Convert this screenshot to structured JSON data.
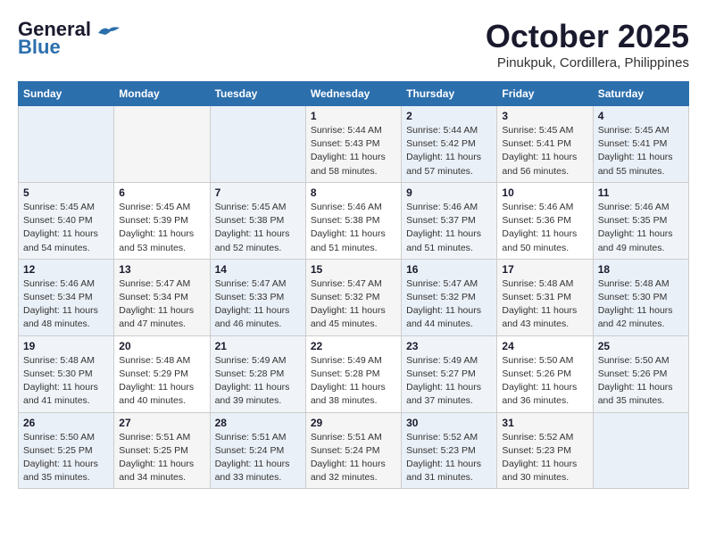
{
  "header": {
    "logo_general": "General",
    "logo_blue": "Blue",
    "month": "October 2025",
    "location": "Pinukpuk, Cordillera, Philippines"
  },
  "days_of_week": [
    "Sunday",
    "Monday",
    "Tuesday",
    "Wednesday",
    "Thursday",
    "Friday",
    "Saturday"
  ],
  "weeks": [
    [
      {
        "day": "",
        "info": ""
      },
      {
        "day": "",
        "info": ""
      },
      {
        "day": "",
        "info": ""
      },
      {
        "day": "1",
        "info": "Sunrise: 5:44 AM\nSunset: 5:43 PM\nDaylight: 11 hours and 58 minutes."
      },
      {
        "day": "2",
        "info": "Sunrise: 5:44 AM\nSunset: 5:42 PM\nDaylight: 11 hours and 57 minutes."
      },
      {
        "day": "3",
        "info": "Sunrise: 5:45 AM\nSunset: 5:41 PM\nDaylight: 11 hours and 56 minutes."
      },
      {
        "day": "4",
        "info": "Sunrise: 5:45 AM\nSunset: 5:41 PM\nDaylight: 11 hours and 55 minutes."
      }
    ],
    [
      {
        "day": "5",
        "info": "Sunrise: 5:45 AM\nSunset: 5:40 PM\nDaylight: 11 hours and 54 minutes."
      },
      {
        "day": "6",
        "info": "Sunrise: 5:45 AM\nSunset: 5:39 PM\nDaylight: 11 hours and 53 minutes."
      },
      {
        "day": "7",
        "info": "Sunrise: 5:45 AM\nSunset: 5:38 PM\nDaylight: 11 hours and 52 minutes."
      },
      {
        "day": "8",
        "info": "Sunrise: 5:46 AM\nSunset: 5:38 PM\nDaylight: 11 hours and 51 minutes."
      },
      {
        "day": "9",
        "info": "Sunrise: 5:46 AM\nSunset: 5:37 PM\nDaylight: 11 hours and 51 minutes."
      },
      {
        "day": "10",
        "info": "Sunrise: 5:46 AM\nSunset: 5:36 PM\nDaylight: 11 hours and 50 minutes."
      },
      {
        "day": "11",
        "info": "Sunrise: 5:46 AM\nSunset: 5:35 PM\nDaylight: 11 hours and 49 minutes."
      }
    ],
    [
      {
        "day": "12",
        "info": "Sunrise: 5:46 AM\nSunset: 5:34 PM\nDaylight: 11 hours and 48 minutes."
      },
      {
        "day": "13",
        "info": "Sunrise: 5:47 AM\nSunset: 5:34 PM\nDaylight: 11 hours and 47 minutes."
      },
      {
        "day": "14",
        "info": "Sunrise: 5:47 AM\nSunset: 5:33 PM\nDaylight: 11 hours and 46 minutes."
      },
      {
        "day": "15",
        "info": "Sunrise: 5:47 AM\nSunset: 5:32 PM\nDaylight: 11 hours and 45 minutes."
      },
      {
        "day": "16",
        "info": "Sunrise: 5:47 AM\nSunset: 5:32 PM\nDaylight: 11 hours and 44 minutes."
      },
      {
        "day": "17",
        "info": "Sunrise: 5:48 AM\nSunset: 5:31 PM\nDaylight: 11 hours and 43 minutes."
      },
      {
        "day": "18",
        "info": "Sunrise: 5:48 AM\nSunset: 5:30 PM\nDaylight: 11 hours and 42 minutes."
      }
    ],
    [
      {
        "day": "19",
        "info": "Sunrise: 5:48 AM\nSunset: 5:30 PM\nDaylight: 11 hours and 41 minutes."
      },
      {
        "day": "20",
        "info": "Sunrise: 5:48 AM\nSunset: 5:29 PM\nDaylight: 11 hours and 40 minutes."
      },
      {
        "day": "21",
        "info": "Sunrise: 5:49 AM\nSunset: 5:28 PM\nDaylight: 11 hours and 39 minutes."
      },
      {
        "day": "22",
        "info": "Sunrise: 5:49 AM\nSunset: 5:28 PM\nDaylight: 11 hours and 38 minutes."
      },
      {
        "day": "23",
        "info": "Sunrise: 5:49 AM\nSunset: 5:27 PM\nDaylight: 11 hours and 37 minutes."
      },
      {
        "day": "24",
        "info": "Sunrise: 5:50 AM\nSunset: 5:26 PM\nDaylight: 11 hours and 36 minutes."
      },
      {
        "day": "25",
        "info": "Sunrise: 5:50 AM\nSunset: 5:26 PM\nDaylight: 11 hours and 35 minutes."
      }
    ],
    [
      {
        "day": "26",
        "info": "Sunrise: 5:50 AM\nSunset: 5:25 PM\nDaylight: 11 hours and 35 minutes."
      },
      {
        "day": "27",
        "info": "Sunrise: 5:51 AM\nSunset: 5:25 PM\nDaylight: 11 hours and 34 minutes."
      },
      {
        "day": "28",
        "info": "Sunrise: 5:51 AM\nSunset: 5:24 PM\nDaylight: 11 hours and 33 minutes."
      },
      {
        "day": "29",
        "info": "Sunrise: 5:51 AM\nSunset: 5:24 PM\nDaylight: 11 hours and 32 minutes."
      },
      {
        "day": "30",
        "info": "Sunrise: 5:52 AM\nSunset: 5:23 PM\nDaylight: 11 hours and 31 minutes."
      },
      {
        "day": "31",
        "info": "Sunrise: 5:52 AM\nSunset: 5:23 PM\nDaylight: 11 hours and 30 minutes."
      },
      {
        "day": "",
        "info": ""
      }
    ]
  ]
}
